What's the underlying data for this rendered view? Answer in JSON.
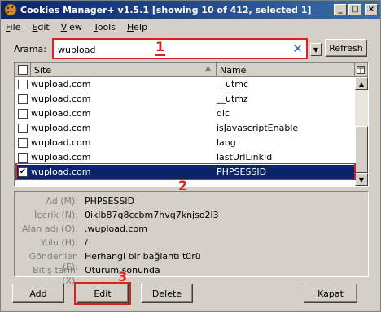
{
  "titlebar": {
    "title": "Cookies Manager+ v1.5.1 [showing 10 of 412, selected 1]"
  },
  "menu": [
    {
      "label": "File",
      "u": "F",
      "rest": "ile"
    },
    {
      "label": "Edit",
      "u": "E",
      "rest": "dit"
    },
    {
      "label": "View",
      "u": "V",
      "rest": "iew"
    },
    {
      "label": "Tools",
      "u": "T",
      "rest": "ools"
    },
    {
      "label": "Help",
      "u": "H",
      "rest": "elp"
    }
  ],
  "search": {
    "label": "Arama:",
    "value": "wupload",
    "refresh_label": "Refresh"
  },
  "annotations": {
    "one": "1",
    "two": "2",
    "three": "3"
  },
  "list": {
    "columns": {
      "site": "Site",
      "name": "Name"
    },
    "rows": [
      {
        "site": "wupload.com",
        "name": "__utmc",
        "checked": false,
        "selected": false
      },
      {
        "site": "wupload.com",
        "name": "__utmz",
        "checked": false,
        "selected": false
      },
      {
        "site": "wupload.com",
        "name": "dlc",
        "checked": false,
        "selected": false
      },
      {
        "site": "wupload.com",
        "name": "isJavascriptEnable",
        "checked": false,
        "selected": false
      },
      {
        "site": "wupload.com",
        "name": "lang",
        "checked": false,
        "selected": false
      },
      {
        "site": "wupload.com",
        "name": "lastUrlLinkId",
        "checked": false,
        "selected": false
      },
      {
        "site": "wupload.com",
        "name": "PHPSESSID",
        "checked": true,
        "selected": true
      }
    ]
  },
  "details": {
    "ad_label": "Ad (M):",
    "ad_value": "PHPSESSID",
    "icerik_label": "İçerik (N):",
    "icerik_value": "0iklb87g8ccbm7hvq7knjso2l3",
    "alan_label": "Alan adı (O):",
    "alan_value": ".wupload.com",
    "yolu_label": "Yolu (H):",
    "yolu_value": "/",
    "gonderilen_label": "Gönderilen (E):",
    "gonderilen_value": "Herhangi bir bağlantı türü",
    "bitis_label": "Bitiş tarihi (X):",
    "bitis_value": "Oturum sonunda"
  },
  "buttons": {
    "add": "Add",
    "edit": "Edit",
    "delete": "Delete",
    "kapat": "Kapat"
  }
}
